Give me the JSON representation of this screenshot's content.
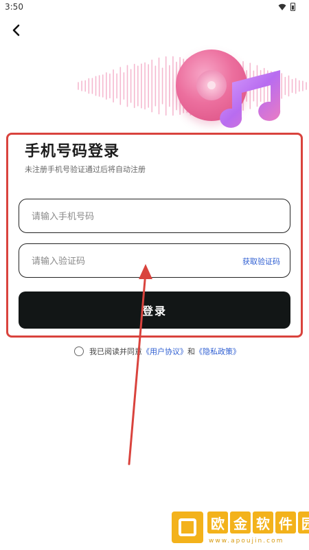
{
  "status_bar": {
    "time": "3:50"
  },
  "header": {
    "title": "手机号码登录",
    "subtitle": "未注册手机号验证通过后将自动注册"
  },
  "form": {
    "phone_placeholder": "请输入手机号码",
    "code_placeholder": "请输入验证码",
    "get_code_label": "获取验证码",
    "login_label": "登录"
  },
  "agreement": {
    "prefix": "我已阅读并同意",
    "user_agreement": "《用户协议》",
    "and": "和",
    "privacy_policy": "《隐私政策》"
  },
  "watermark": {
    "chars": [
      "欧",
      "金",
      "软",
      "件",
      "园"
    ],
    "url": "www.apoujin.com"
  },
  "colors": {
    "accent_link": "#2f5fd2",
    "annotation_red": "#d9433d",
    "button_dark": "#121616",
    "disc_pink": "#ec6f9e",
    "note_purple": "#b86cf0",
    "watermark_gold": "#f3b21b"
  },
  "icons": {
    "back": "chevron-left-icon",
    "wifi": "wifi-icon",
    "battery": "battery-icon",
    "music_note": "music-note-icon",
    "disc": "disc-icon"
  }
}
